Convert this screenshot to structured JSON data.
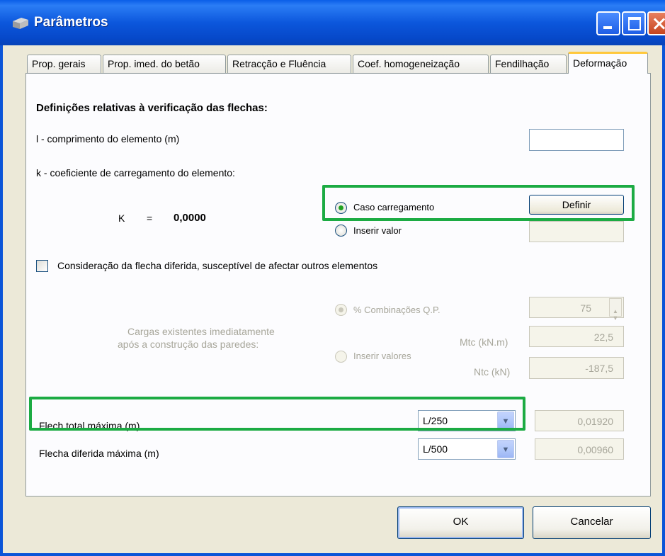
{
  "window": {
    "title": "Parâmetros"
  },
  "tabs": [
    {
      "label": "Prop. gerais"
    },
    {
      "label": "Prop. imed. do betão"
    },
    {
      "label": "Retracção e Fluência"
    },
    {
      "label": "Coef. homogeneização"
    },
    {
      "label": "Fendilhação"
    },
    {
      "label": "Deformação"
    }
  ],
  "panel": {
    "heading": "Definições relativas à verificação das flechas:",
    "length_label": "l - comprimento do elemento (m)",
    "length_value": "",
    "k_label": "k - coeficiente de carregamento do elemento:",
    "k_prefix": "K",
    "k_equals": "=",
    "k_value": "0,0000",
    "radio_caso": "Caso carregamento",
    "define_button": "Definir",
    "radio_inserir": "Inserir valor",
    "inserir_valor_value": "",
    "deferred_checkbox": "Consideração da flecha diferida, susceptível de afectar outros elementos",
    "existing_loads_label_1": "Cargas existentes imediatamente",
    "existing_loads_label_2": "após a construção das paredes:",
    "radio_combinacoes": "% Combinações Q.P.",
    "combinacoes_value": "75",
    "radio_inserir_valores": "Inserir valores",
    "mtc_label": "Mtc (kN.m)",
    "mtc_value": "22,5",
    "ntc_label": "Ntc (kN)",
    "ntc_value": "-187,5",
    "flecha_total_label": "Flech total máxima (m)",
    "flecha_total_select": "L/250",
    "flecha_total_value": "0,01920",
    "flecha_diferida_label": "Flecha diferida máxima (m)",
    "flecha_diferida_select": "L/500",
    "flecha_diferida_value": "0,00960"
  },
  "buttons": {
    "ok": "OK",
    "cancel": "Cancelar"
  },
  "colors": {
    "highlight": "#1cab43",
    "titlebar": "#0c57dc"
  }
}
